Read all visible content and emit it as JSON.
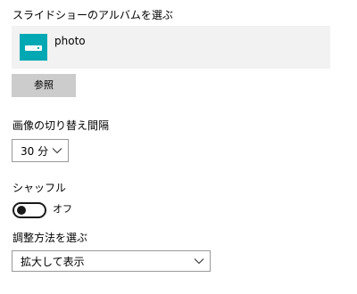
{
  "album_section": {
    "label": "スライドショーのアルバムを選ぶ",
    "album_name": "photo",
    "album_icon": "album-icon",
    "browse_label": "参照"
  },
  "interval_section": {
    "label": "画像の切り替え間隔",
    "selected": "30 分",
    "dropdown_icon": "chevron-down-icon"
  },
  "shuffle_section": {
    "label": "シャッフル",
    "toggle_state": "オフ",
    "enabled": false
  },
  "fit_section": {
    "label": "調整方法を選ぶ",
    "selected": "拡大して表示",
    "dropdown_icon": "chevron-down-icon"
  },
  "colors": {
    "accent": "#00a8b4",
    "tile_background": "#f2f2f2",
    "button_background": "#cccccc",
    "toggle_off": "#1a1a1a"
  }
}
